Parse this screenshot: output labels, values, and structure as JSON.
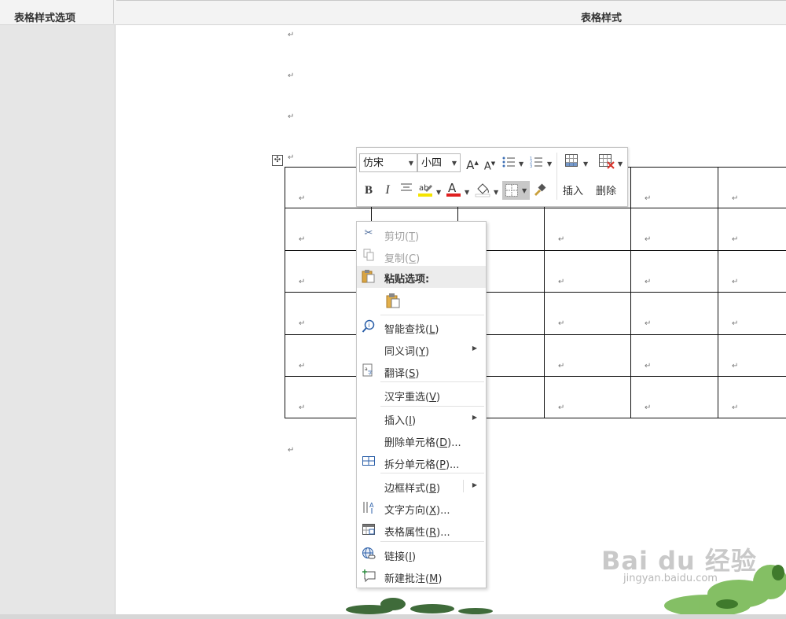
{
  "ribbon": {
    "group_left_label": "表格样式选项",
    "group_main_label": "表格样式"
  },
  "paragraph_mark": "↵",
  "table": {
    "move_handle_icon": "move-icon",
    "cell_mark": "↵"
  },
  "mini_toolbar": {
    "font_name": "仿宋",
    "font_size": "小四",
    "grow_font": "A",
    "shrink_font": "A",
    "bold": "B",
    "italic": "I",
    "font_color_glyph": "A",
    "highlight_glyph": "ab",
    "insert_label": "插入",
    "delete_label": "删除",
    "font_color": "#e02020",
    "highlight_color": "#f5e400"
  },
  "context_menu": {
    "cut": {
      "text": "剪切",
      "key": "T"
    },
    "copy": {
      "text": "复制",
      "key": "C"
    },
    "paste_options": "粘贴选项:",
    "smart_lookup": {
      "text": "智能查找",
      "key": "L"
    },
    "synonyms": {
      "text": "同义词",
      "key": "Y"
    },
    "translate": {
      "text": "翻译",
      "key": "S"
    },
    "hanzi_reselect": {
      "text": "汉字重选",
      "key": "V"
    },
    "insert": {
      "text": "插入",
      "key": "I"
    },
    "delete_cells": {
      "text": "删除单元格",
      "key": "D",
      "suffix": "..."
    },
    "split_cells": {
      "text": "拆分单元格",
      "key": "P",
      "suffix": "..."
    },
    "border_styles": {
      "text": "边框样式",
      "key": "B"
    },
    "text_direction": {
      "text": "文字方向",
      "key": "X",
      "suffix": "..."
    },
    "table_properties": {
      "text": "表格属性",
      "key": "R",
      "suffix": "..."
    },
    "link": {
      "text": "链接",
      "key": "I"
    },
    "new_comment": {
      "text": "新建批注",
      "key": "M"
    }
  },
  "watermark": {
    "logo": "Bai du 经验",
    "url": "jingyan.baidu.com"
  }
}
